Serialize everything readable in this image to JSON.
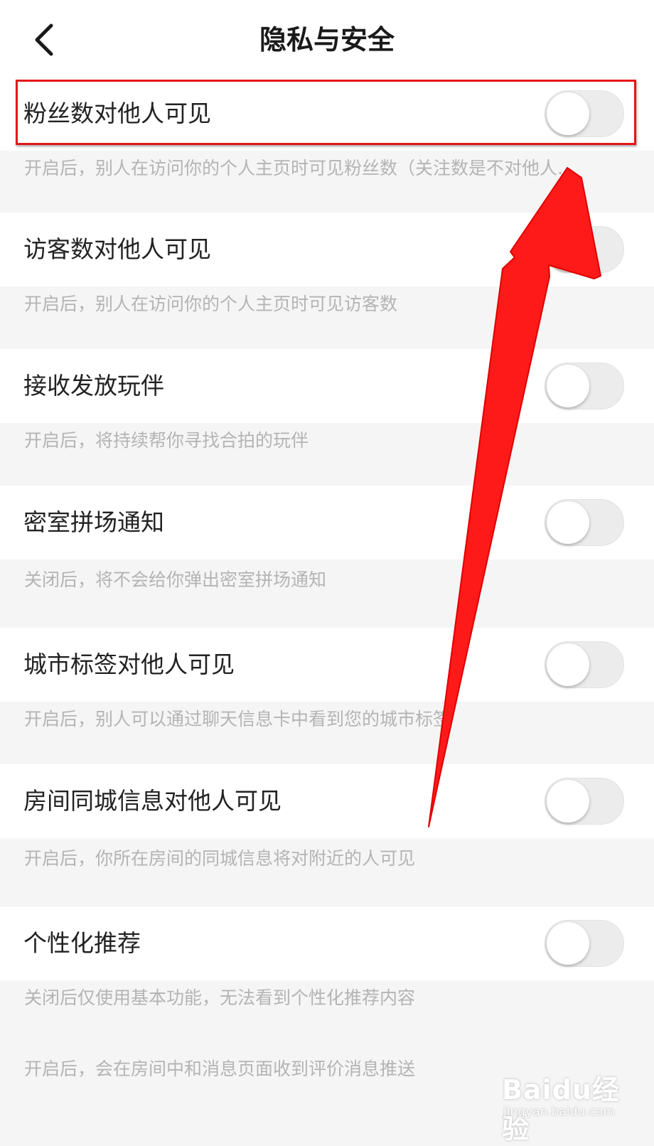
{
  "header": {
    "title": "隐私与安全",
    "back_icon": "chevron-left-icon"
  },
  "settings": [
    {
      "label": "粉丝数对他人可见",
      "description": "开启后，别人在访问你的个人主页时可见粉丝数（关注数是不对他人...",
      "enabled": false
    },
    {
      "label": "访客数对他人可见",
      "description": "开启后，别人在访问你的个人主页时可见访客数",
      "enabled": false
    },
    {
      "label": "接收发放玩伴",
      "description": "开启后，将持续帮你寻找合拍的玩伴",
      "enabled": false
    },
    {
      "label": "密室拼场通知",
      "description": "关闭后，将不会给你弹出密室拼场通知",
      "enabled": false
    },
    {
      "label": "城市标签对他人可见",
      "description": "开启后，别人可以通过聊天信息卡中看到您的城市标签",
      "enabled": false
    },
    {
      "label": "房间同城信息对他人可见",
      "description": "开启后，你所在房间的同城信息将对附近的人可见",
      "enabled": false
    },
    {
      "label": "个性化推荐",
      "description": "关闭后仅使用基本功能，无法看到个性化推荐内容",
      "enabled": false
    }
  ],
  "partial_description": "开启后，会在房间中和消息页面收到评价消息推送",
  "annotation": {
    "highlight_color": "#e3161b",
    "arrow_color": "#ff1a1a"
  },
  "watermark": {
    "main": "Baidu经验",
    "sub": "jingyan.baidu.com"
  }
}
